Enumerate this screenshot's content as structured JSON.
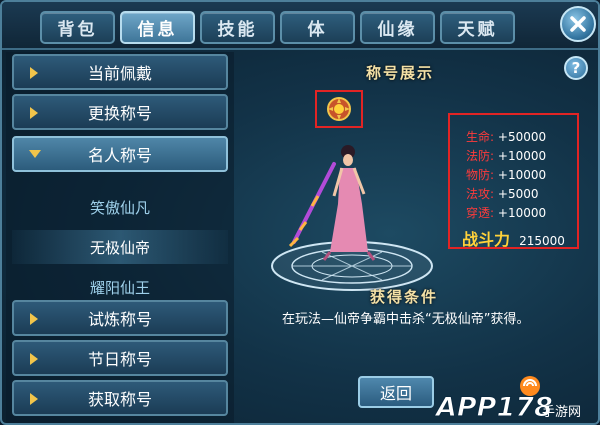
{
  "tabs": [
    {
      "label": "背包",
      "active": false
    },
    {
      "label": "信息",
      "active": true
    },
    {
      "label": "技能",
      "active": false
    },
    {
      "label": "体",
      "active": false
    },
    {
      "label": "仙缘",
      "active": false
    },
    {
      "label": "天赋",
      "active": false
    }
  ],
  "menu": {
    "current_worn": "当前佩戴",
    "change_title": "更换称号",
    "celebrity_title": "名人称号",
    "celebrity_items": [
      "笑傲仙凡",
      "无极仙帝",
      "耀阳仙王"
    ],
    "selected_item": "无极仙帝",
    "trial_title": "试炼称号",
    "festival_title": "节日称号",
    "obtain_title": "获取称号"
  },
  "display": {
    "title": "称号展示",
    "help": "?"
  },
  "stats": [
    {
      "key": "生命",
      "value": "+50000"
    },
    {
      "key": "法防",
      "value": "+10000"
    },
    {
      "key": "物防",
      "value": "+10000"
    },
    {
      "key": "法攻",
      "value": "+5000"
    },
    {
      "key": "穿透",
      "value": "+10000"
    }
  ],
  "power": {
    "label": "战斗力",
    "value": "215000"
  },
  "condition": {
    "title": "获得条件",
    "description": "在玩法—仙帝争霸中击杀“无极仙帝”获得。"
  },
  "back_label": "返回",
  "watermark": {
    "main": "APP178",
    "sub": "手游网"
  },
  "colors": {
    "stat_key": "#ff3b3b",
    "power_label": "#ffd23a",
    "highlight_border": "#e22424",
    "title_gold": "#f4e1a6"
  }
}
